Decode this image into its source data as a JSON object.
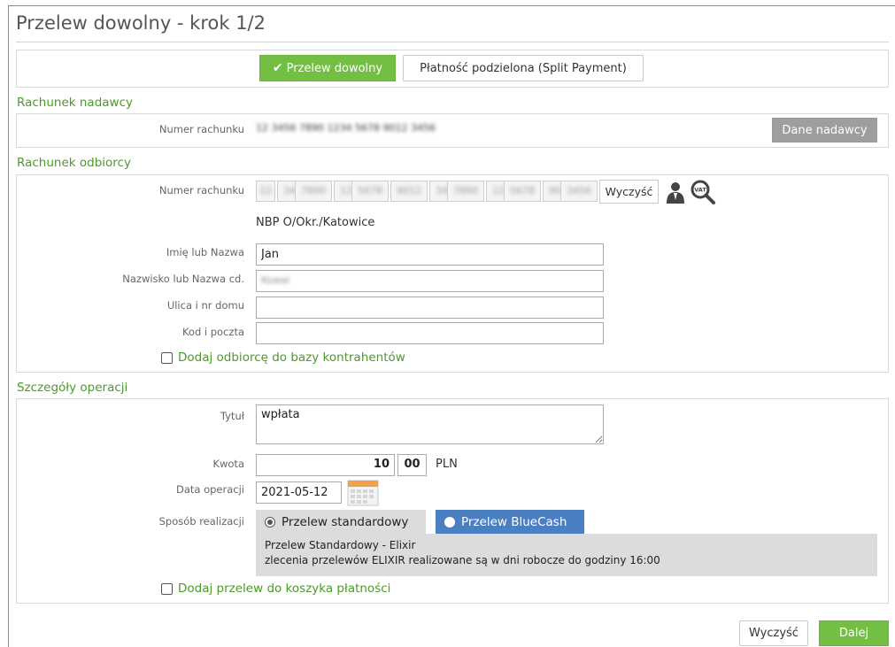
{
  "page": {
    "title": "Przelew dowolny - krok 1/2"
  },
  "transfer_type": {
    "active_label": "Przelew dowolny",
    "split_label": "Płatność podzielona (Split Payment)"
  },
  "sender": {
    "section_title": "Rachunek nadawcy",
    "account_label": "Numer rachunku",
    "account_value": "12 3456 7890 1234 5678 9012 3456",
    "details_button": "Dane nadawcy"
  },
  "recipient": {
    "section_title": "Rachunek odbiorcy",
    "account_label": "Numer rachunku",
    "account_segments": [
      "12",
      "3456",
      "7890",
      "1234",
      "5678",
      "9012",
      "3456",
      "7890",
      "1234",
      "5678",
      "9012",
      "3456",
      "7890"
    ],
    "clear_button": "Wyczyść",
    "bank_name": "NBP O/Okr./Katowice",
    "name_label": "Imię lub Nazwa",
    "name_value": "Jan",
    "surname_label": "Nazwisko lub Nazwa cd.",
    "surname_value": "Kowal",
    "street_label": "Ulica i nr domu",
    "street_value": "",
    "postal_label": "Kod i poczta",
    "postal_value": "",
    "add_contractor_label": "Dodaj odbiorcę do bazy kontrahentów"
  },
  "operation": {
    "section_title": "Szczegóły operacji",
    "title_label": "Tytuł",
    "title_value": "wpłata",
    "amount_label": "Kwota",
    "amount_int": "10",
    "amount_dec": "00",
    "currency": "PLN",
    "date_label": "Data operacji",
    "date_value": "2021-05-12",
    "mode_label": "Sposób realizacji",
    "mode_standard": "Przelew standardowy",
    "mode_bluecash": "Przelew BlueCash",
    "info_line1": "Przelew Standardowy - Elixir",
    "info_line2": "zlecenia przelewów ELIXIR realizowane są w dni robocze do godziny 16:00",
    "add_basket_label": "Dodaj przelew do koszyka płatności"
  },
  "footer": {
    "clear_button": "Wyczyść",
    "next_button": "Dalej"
  },
  "colors": {
    "accent_green": "#72bf44",
    "section_green": "#4c9a2a",
    "bluecash_blue": "#4a7fc1"
  }
}
